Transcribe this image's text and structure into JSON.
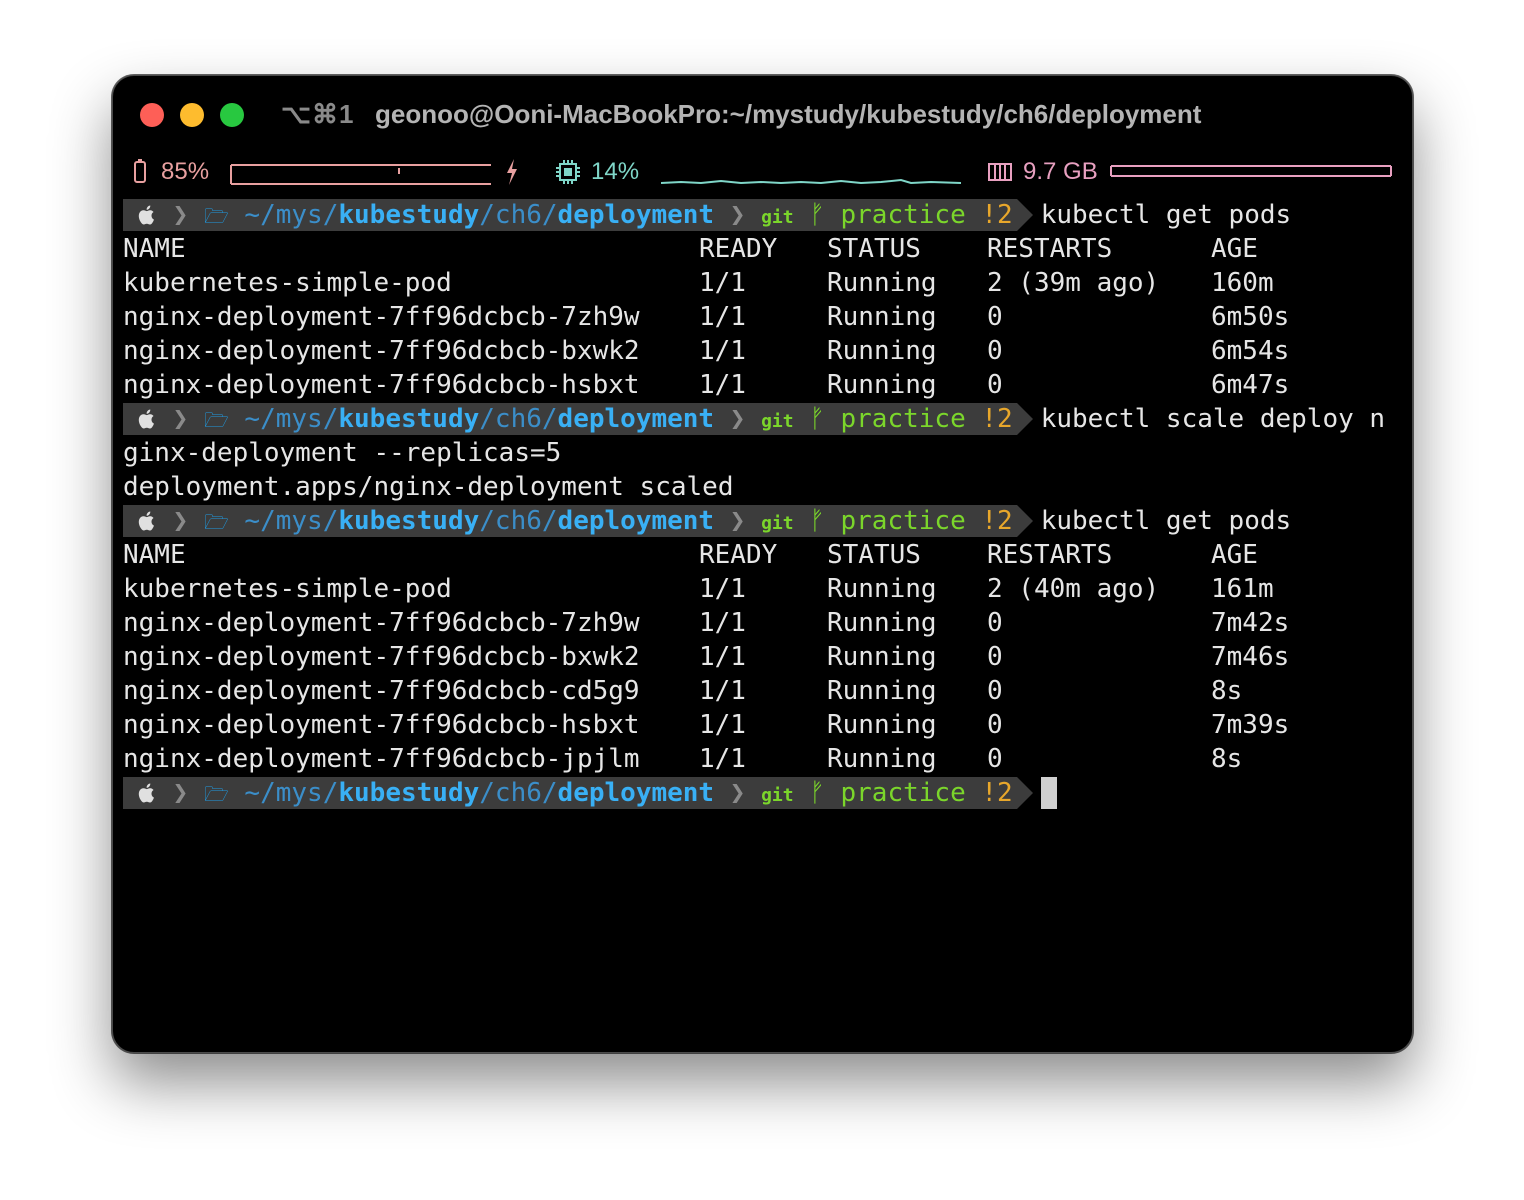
{
  "window": {
    "shortcut": "⌥⌘1",
    "title": "geonoo@Ooni-MacBookPro:~/mystudy/kubestudy/ch6/deployment"
  },
  "status": {
    "battery_label": "85%",
    "cpu_label": "14%",
    "mem_label": "9.7 GB",
    "colors": {
      "battery": "#e8a0a0",
      "cpu": "#7fd6c8",
      "mem": "#e8a0c0"
    },
    "icons": {
      "battery": "battery-icon",
      "charging": "bolt-icon",
      "cpu": "cpu-chip-icon",
      "mem": "memory-icon"
    }
  },
  "prompt": {
    "apple": "",
    "dir_home": "~/",
    "dir_mys": "mys",
    "slash": "/",
    "dir_kube": "kubestudy",
    "dir_ch6": "ch6",
    "dir_deploy": "deployment",
    "git_label": "git",
    "branch_icon": "ᚠ",
    "branch": "practice",
    "dirty": "!2"
  },
  "commands": {
    "cmd1": "kubectl get pods",
    "cmd2": "kubectl scale deploy n",
    "cmd2_cont": "ginx-deployment --replicas=5",
    "scaled": "deployment.apps/nginx-deployment scaled",
    "cmd3": "kubectl get pods"
  },
  "headers": [
    "NAME",
    "READY",
    "STATUS",
    "RESTARTS",
    "AGE"
  ],
  "pods1": [
    [
      "kubernetes-simple-pod",
      "1/1",
      "Running",
      "2 (39m ago)",
      "160m"
    ],
    [
      "nginx-deployment-7ff96dcbcb-7zh9w",
      "1/1",
      "Running",
      "0",
      "6m50s"
    ],
    [
      "nginx-deployment-7ff96dcbcb-bxwk2",
      "1/1",
      "Running",
      "0",
      "6m54s"
    ],
    [
      "nginx-deployment-7ff96dcbcb-hsbxt",
      "1/1",
      "Running",
      "0",
      "6m47s"
    ]
  ],
  "pods2": [
    [
      "kubernetes-simple-pod",
      "1/1",
      "Running",
      "2 (40m ago)",
      "161m"
    ],
    [
      "nginx-deployment-7ff96dcbcb-7zh9w",
      "1/1",
      "Running",
      "0",
      "7m42s"
    ],
    [
      "nginx-deployment-7ff96dcbcb-bxwk2",
      "1/1",
      "Running",
      "0",
      "7m46s"
    ],
    [
      "nginx-deployment-7ff96dcbcb-cd5g9",
      "1/1",
      "Running",
      "0",
      "8s"
    ],
    [
      "nginx-deployment-7ff96dcbcb-hsbxt",
      "1/1",
      "Running",
      "0",
      "7m39s"
    ],
    [
      "nginx-deployment-7ff96dcbcb-jpjlm",
      "1/1",
      "Running",
      "0",
      "8s"
    ]
  ]
}
